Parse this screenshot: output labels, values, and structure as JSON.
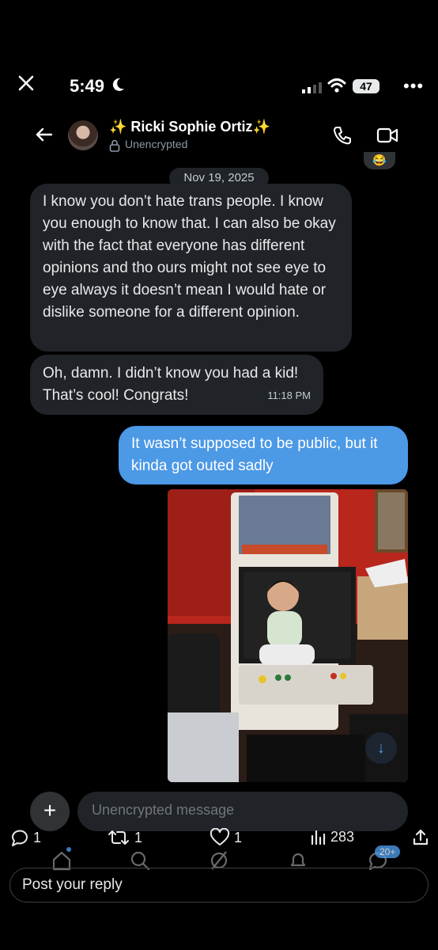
{
  "status": {
    "time": "5:49",
    "battery": "47"
  },
  "header": {
    "name": "✨ Ricki Sophie Ortiz✨",
    "encryption": "Unencrypted"
  },
  "reaction": "😂",
  "date": "Nov 19, 2025",
  "messages": [
    {
      "from": "them",
      "text": "I know you don’t hate trans people. I know you enough to know that. I can also be okay with the fact that everyone has different opinions and tho ours might not see eye to eye always it doesn’t mean I would hate or dislike someone for a different opinion."
    },
    {
      "from": "them",
      "text": "Oh, damn. I didn’t know you had a kid! That’s cool! Congrats!",
      "time": "11:18 PM"
    },
    {
      "from": "me",
      "text": "It wasn’t supposed to be public, but it kinda got outed sadly"
    }
  ],
  "composer": {
    "placeholder": "Unencrypted message"
  },
  "engagement": {
    "replies": "1",
    "reposts": "1",
    "likes": "1",
    "views": "283"
  },
  "nav": {
    "badge": "20+"
  },
  "reply": {
    "placeholder": "Post your reply"
  },
  "colors": {
    "accent": "#4c99e6",
    "bubble_incoming": "#202327",
    "background": "#000000"
  }
}
